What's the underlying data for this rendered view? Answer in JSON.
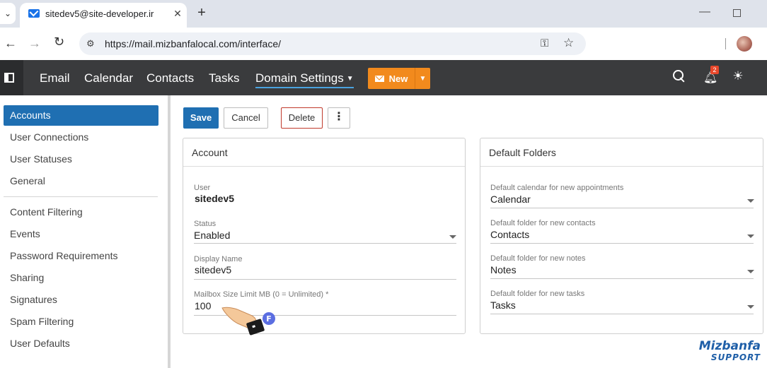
{
  "browser": {
    "tab_title": "sitedev5@site-developer.ir",
    "url": "https://mail.mizbanfalocal.com/interface/"
  },
  "nav": {
    "items": [
      "Email",
      "Calendar",
      "Contacts",
      "Tasks",
      "Domain Settings"
    ],
    "active": "Domain Settings",
    "new_label": "New",
    "notification_count": "2"
  },
  "sidebar": {
    "items": [
      "Accounts",
      "User Connections",
      "User Statuses",
      "General",
      "Content Filtering",
      "Events",
      "Password Requirements",
      "Sharing",
      "Signatures",
      "Spam Filtering",
      "User Defaults"
    ],
    "active": "Accounts"
  },
  "toolbar": {
    "save_label": "Save",
    "cancel_label": "Cancel",
    "delete_label": "Delete",
    "more_label": "⋮"
  },
  "account": {
    "title": "Account",
    "user_label": "User",
    "user_value": "sitedev5",
    "status_label": "Status",
    "status_value": "Enabled",
    "display_name_label": "Display Name",
    "display_name_value": "sitedev5",
    "mailbox_label": "Mailbox Size Limit MB (0 = Unlimited) *",
    "mailbox_value": "100"
  },
  "folders": {
    "title": "Default Folders",
    "calendar_label": "Default calendar for new appointments",
    "calendar_value": "Calendar",
    "contacts_label": "Default folder for new contacts",
    "contacts_value": "Contacts",
    "notes_label": "Default folder for new notes",
    "notes_value": "Notes",
    "tasks_label": "Default folder for new tasks",
    "tasks_value": "Tasks"
  },
  "brand": {
    "name": "Mizbanfa",
    "sub": "SUPPORT"
  },
  "colors": {
    "accent": "#1f6fb2",
    "new_button": "#f28a1d",
    "nav_bg": "#3a3b3d",
    "badge": "#e8472b"
  }
}
